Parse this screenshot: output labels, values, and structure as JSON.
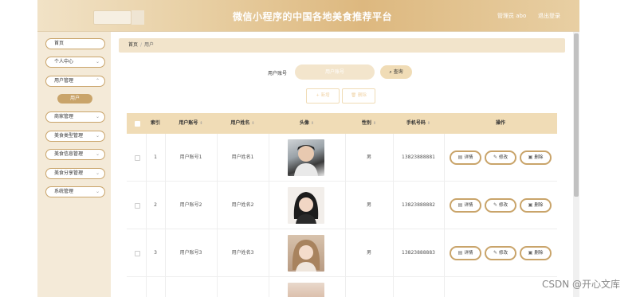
{
  "header": {
    "title": "微信小程序的中国各地美食推荐平台",
    "user_info": "管理员 abo",
    "logout": "退出登录"
  },
  "sidebar": {
    "items": [
      {
        "label": "首页",
        "has_chevron": false
      },
      {
        "label": "个人中心",
        "has_chevron": true
      },
      {
        "label": "用户管理",
        "has_chevron": true
      },
      {
        "label": "商家管理",
        "has_chevron": true
      },
      {
        "label": "美食类型管理",
        "has_chevron": true
      },
      {
        "label": "美食信息管理",
        "has_chevron": true
      },
      {
        "label": "美食分享管理",
        "has_chevron": true
      },
      {
        "label": "系统管理",
        "has_chevron": true
      }
    ],
    "active_sub": "用户"
  },
  "breadcrumb": {
    "home": "首页",
    "sep": "/",
    "current": "用户"
  },
  "search": {
    "label": "用户账号",
    "placeholder": "用户账号",
    "button": "查询",
    "button_icon": "search-icon"
  },
  "toolbar": {
    "add_label": "+ 新增",
    "delete_label": "删除",
    "delete_icon": "trash-icon"
  },
  "table": {
    "headers": {
      "index": "索引",
      "account": "用户账号",
      "name": "用户姓名",
      "avatar": "头像",
      "gender": "性别",
      "phone": "手机号码",
      "actions": "操作"
    },
    "rows": [
      {
        "index": "1",
        "account": "用户账号1",
        "name": "用户姓名1",
        "gender": "男",
        "phone": "13823888881"
      },
      {
        "index": "2",
        "account": "用户账号2",
        "name": "用户姓名2",
        "gender": "男",
        "phone": "13823888882"
      },
      {
        "index": "3",
        "account": "用户账号3",
        "name": "用户姓名3",
        "gender": "男",
        "phone": "13823888883"
      }
    ],
    "actions": {
      "detail": "详情",
      "edit": "修改",
      "delete": "删除"
    }
  },
  "colors": {
    "accent": "#c9a46a",
    "header_bg": "#ddb87f",
    "sidebar_bg": "#f4ead8",
    "table_head_bg": "#f0dcb6"
  },
  "watermark": "CSDN @开心文库"
}
